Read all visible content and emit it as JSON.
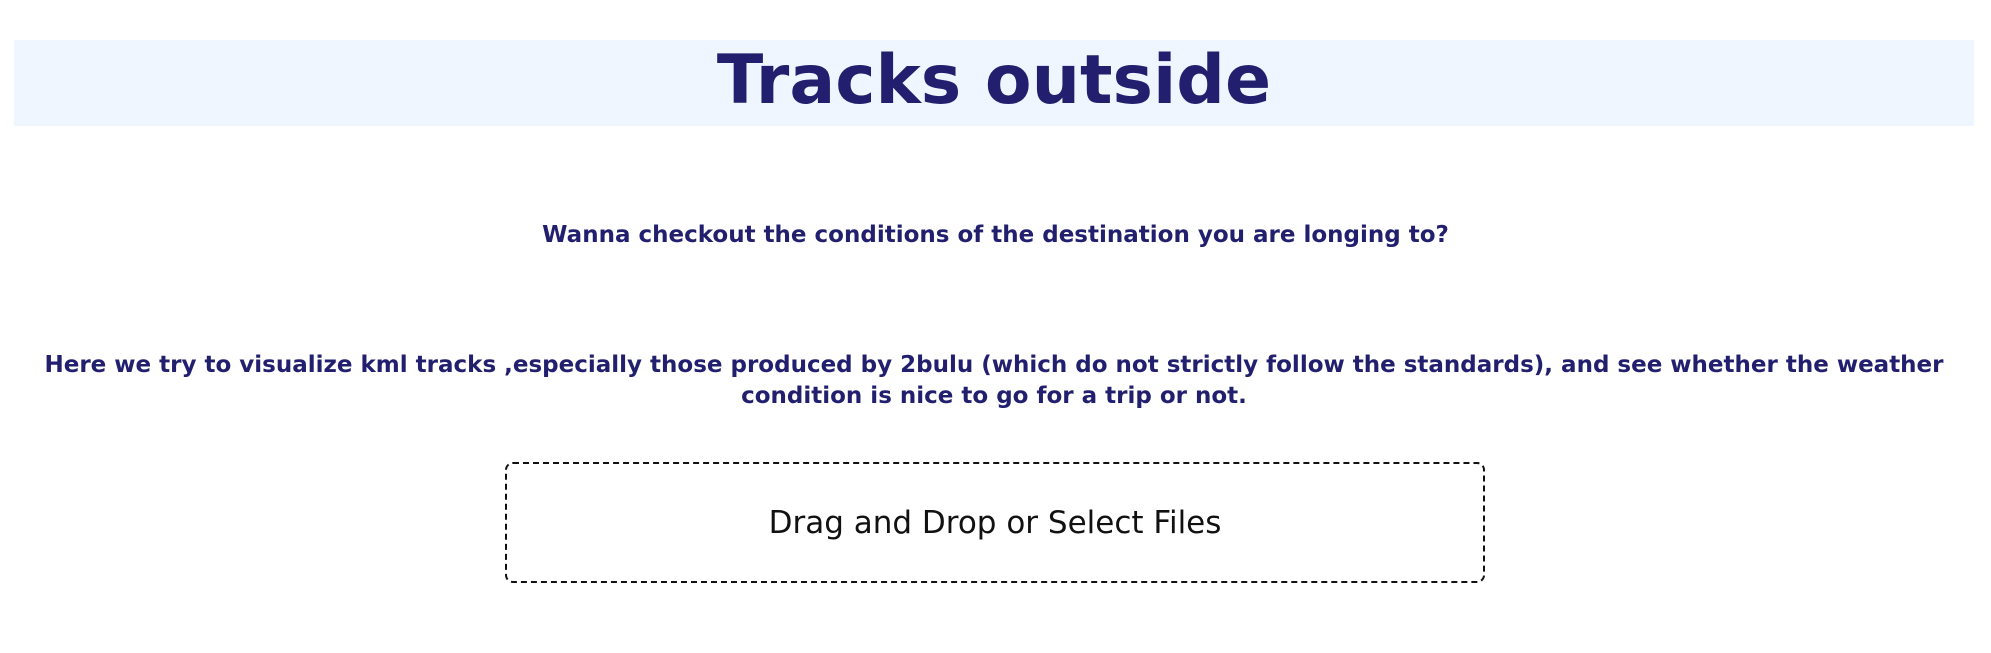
{
  "header": {
    "title": "Tracks outside"
  },
  "intro": {
    "subtitle": "Wanna checkout the conditions of the destination you are longing to?",
    "description": "Here we try to visualize kml tracks ,especially those produced by 2bulu (which do not strictly follow the standards), and see whether the weather condition is nice to go for a trip or not."
  },
  "upload": {
    "label": "Drag and Drop or Select Files"
  },
  "colors": {
    "title_text": "#22206e",
    "header_background": "#f0f6ff",
    "dropzone_border": "#111111"
  }
}
